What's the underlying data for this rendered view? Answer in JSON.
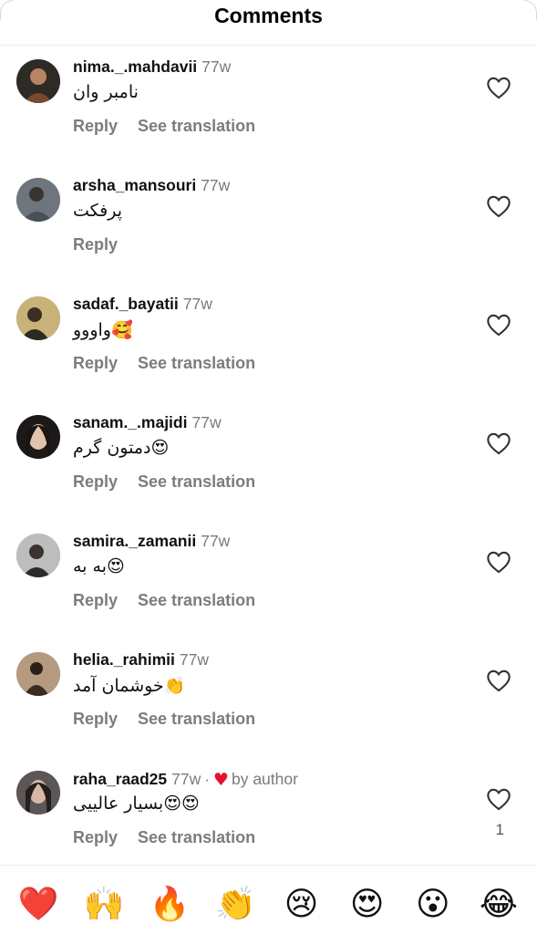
{
  "header": {
    "title": "Comments"
  },
  "comments": [
    {
      "username": "nima._.mahdavii",
      "time": "77w",
      "text": "نامبر وان",
      "reply": "Reply",
      "translate": "See translation",
      "avatar_color": "#7a4a2e"
    },
    {
      "username": "arsha_mansouri",
      "time": "77w",
      "text": "پرفکت",
      "reply": "Reply",
      "translate": "",
      "avatar_color": "#4a5058"
    },
    {
      "username": "sadaf._bayatii",
      "time": "77w",
      "text": "واووو🥰",
      "reply": "Reply",
      "translate": "See translation",
      "avatar_color": "#6d5a2a"
    },
    {
      "username": "sanam._.majidi",
      "time": "77w",
      "text": "دمتون گرم😍",
      "reply": "Reply",
      "translate": "See translation",
      "avatar_color": "#2b2220"
    },
    {
      "username": "samira._zamanii",
      "time": "77w",
      "text": "به به😍",
      "reply": "Reply",
      "translate": "See translation",
      "avatar_color": "#8c8c8c"
    },
    {
      "username": "helia._rahimii",
      "time": "77w",
      "text": "خوشمان آمد👏",
      "reply": "Reply",
      "translate": "See translation",
      "avatar_color": "#5a4636"
    },
    {
      "username": "raha_raad25",
      "time": "77w",
      "text": "بسیار عالییی😍😍",
      "reply": "Reply",
      "translate": "See translation",
      "avatar_color": "#3a3535",
      "liked_by_author": "by author",
      "likes": "1"
    }
  ],
  "reactions": [
    "❤️",
    "🙌",
    "🔥",
    "👏",
    "😢",
    "😍",
    "😮",
    "😂"
  ],
  "colors": {
    "heart_red": "#e8112d",
    "muted_text": "#7a7a7a"
  }
}
